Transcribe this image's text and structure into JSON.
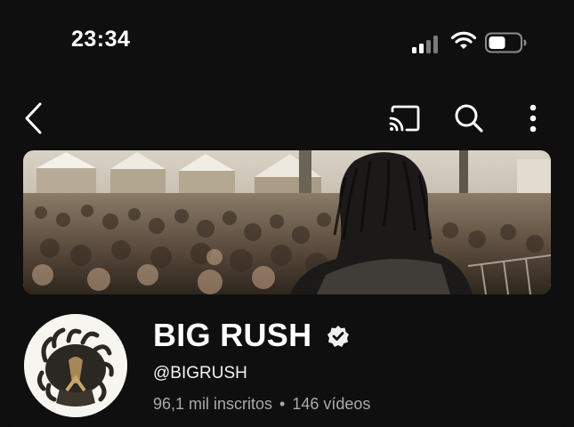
{
  "status_bar": {
    "time": "23:34"
  },
  "channel": {
    "name": "BIG RUSH",
    "handle": "@BIGRUSH",
    "subscribers": "96,1 mil inscritos",
    "separator": "•",
    "videos": "146 vídeos",
    "verified": true
  },
  "icons": {
    "back": "back-arrow-icon",
    "cast": "cast-icon",
    "search": "search-icon",
    "more": "more-vert-icon",
    "verified": "verified-badge-icon"
  },
  "colors": {
    "background": "#0f0f0f",
    "text_primary": "#ffffff",
    "text_secondary": "#aaaaaa"
  }
}
